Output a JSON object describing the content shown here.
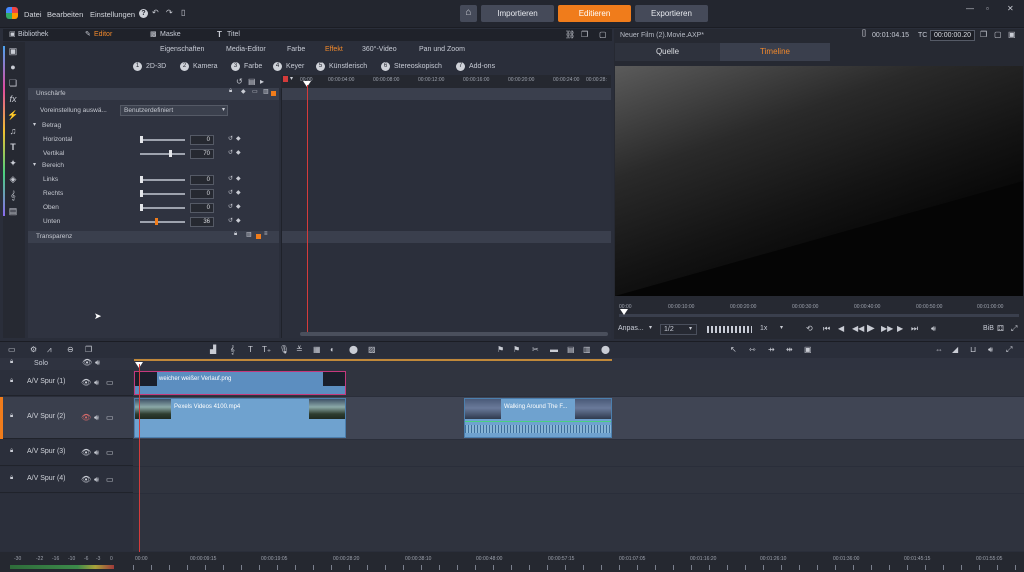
{
  "menu": {
    "items": [
      "Datei",
      "Bearbeiten",
      "Einstellungen"
    ]
  },
  "topbar": {
    "buttons": [
      "Importieren",
      "Editieren",
      "Exportieren"
    ]
  },
  "tabs": {
    "left": [
      "Bibliothek",
      "Editor",
      "Maske",
      "Titel"
    ]
  },
  "subtabs": [
    "Eigenschaften",
    "Media-Editor",
    "Farbe",
    "Effekt",
    "360°-Video",
    "Pan und Zoom"
  ],
  "categories": [
    {
      "num": "1",
      "label": "2D-3D"
    },
    {
      "num": "2",
      "label": "Kamera"
    },
    {
      "num": "3",
      "label": "Farbe"
    },
    {
      "num": "4",
      "label": "Keyer"
    },
    {
      "num": "5",
      "label": "Künstlerisch"
    },
    {
      "num": "6",
      "label": "Stereoskopisch"
    },
    {
      "num": "7",
      "label": "Add-ons"
    }
  ],
  "effect": {
    "title": "Unschärfe",
    "preset_label": "Voreinstellung auswä...",
    "preset_value": "Benutzerdefiniert",
    "groups": [
      {
        "name": "Betrag",
        "rows": [
          {
            "label": "Horizontal",
            "value": "0",
            "level": 0.0
          },
          {
            "label": "Vertikal",
            "value": "70",
            "level": 0.7
          }
        ]
      },
      {
        "name": "Bereich",
        "rows": [
          {
            "label": "Links",
            "value": "0",
            "level": 0.0
          },
          {
            "label": "Rechts",
            "value": "0",
            "level": 0.0
          },
          {
            "label": "Oben",
            "value": "0",
            "level": 0.0
          },
          {
            "label": "Unten",
            "value": "36",
            "level": 0.36,
            "accent": true
          }
        ]
      }
    ],
    "second_effect": "Transparenz"
  },
  "keyframe_ruler": [
    "00:00",
    "00:00:04:00",
    "00:00:08:00",
    "00:00:12:00",
    "00:00:16:00",
    "00:00:20:00",
    "00:00:24:00",
    "00:00:28:"
  ],
  "player": {
    "title": "Neuer Film (2).Movie.AXP*",
    "timecode": "00:01:04.15",
    "tc_label": "TC",
    "tc_value": "00:00:00.20",
    "tabs": [
      "Quelle",
      "Timeline"
    ],
    "ruler": [
      "00:00",
      "00:00:10:00",
      "00:00:20:00",
      "00:00:30:00",
      "00:00:40:00",
      "00:00:50:00",
      "00:01:00:00"
    ],
    "fit_label": "Anpas...",
    "ratio": "1/2",
    "speed": "1x",
    "bib": "BiB"
  },
  "timeline": {
    "solo": "Solo",
    "tracks": [
      {
        "name": "A/V Spur (1)"
      },
      {
        "name": "A/V Spur (2)"
      },
      {
        "name": "A/V Spur (3)"
      },
      {
        "name": "A/V Spur (4)"
      }
    ],
    "clips": {
      "clip1": "weicher weißer Verlauf.png",
      "clip2": "Pexels Videos 4100.mp4",
      "clip3": "Walking Around The F..."
    },
    "ruler": [
      "00:00",
      "00:00:09:15",
      "00:00:19:05",
      "00:00:28:20",
      "00:00:38:10",
      "00:00:48:00",
      "00:00:57:15",
      "00:01:07:05",
      "00:01:16:20",
      "00:01:26:10",
      "00:01:36:00",
      "00:01:45:15",
      "00:01:55:05"
    ],
    "meter": [
      "-30",
      "-22",
      "-16",
      "-10",
      "-6",
      "-3",
      "0"
    ]
  },
  "colors": {
    "accent": "#f07c1b",
    "clip": "#6fa2cf",
    "playhead": "#d43b3b",
    "bg": "#2a2e3a"
  }
}
